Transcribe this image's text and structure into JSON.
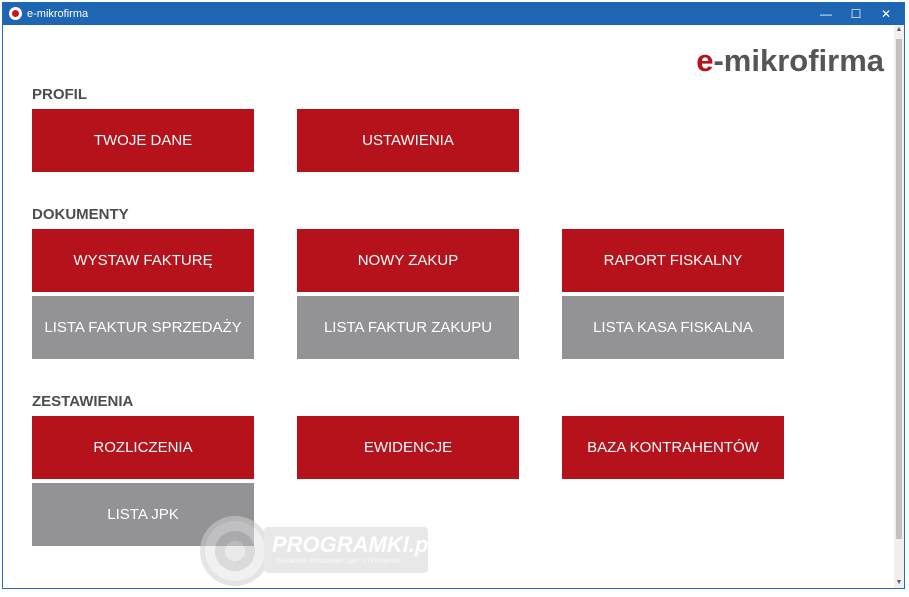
{
  "window": {
    "title": "e-mikrofirma",
    "controls": {
      "minimize": "—",
      "maximize": "☐",
      "close": "✕"
    }
  },
  "logo": {
    "prefix": "e",
    "rest": "-mikrofirma"
  },
  "sections": {
    "profil": {
      "title": "PROFIL",
      "tiles": [
        "TWOJE DANE",
        "USTAWIENIA"
      ]
    },
    "dokumenty": {
      "title": "DOKUMENTY",
      "tiles": [
        "WYSTAW FAKTURĘ",
        "NOWY ZAKUP",
        "RAPORT FISKALNY",
        "LISTA FAKTUR SPRZEDAŻY",
        "LISTA FAKTUR ZAKUPU",
        "LISTA KASA FISKALNA"
      ]
    },
    "zestawienia": {
      "title": "ZESTAWIENIA",
      "tiles": [
        "ROZLICZENIA",
        "EWIDENCJE",
        "BAZA KONTRAHENTÓW",
        "LISTA JPK"
      ]
    }
  },
  "watermark": {
    "brand": "PROGRAMKI.pl",
    "tagline": "DARMOWE PROGRAMY, GRY, STEROWNIKI"
  },
  "colors": {
    "primary": "#b5121b",
    "secondary": "#939396",
    "titlebar": "#1e66b3"
  }
}
